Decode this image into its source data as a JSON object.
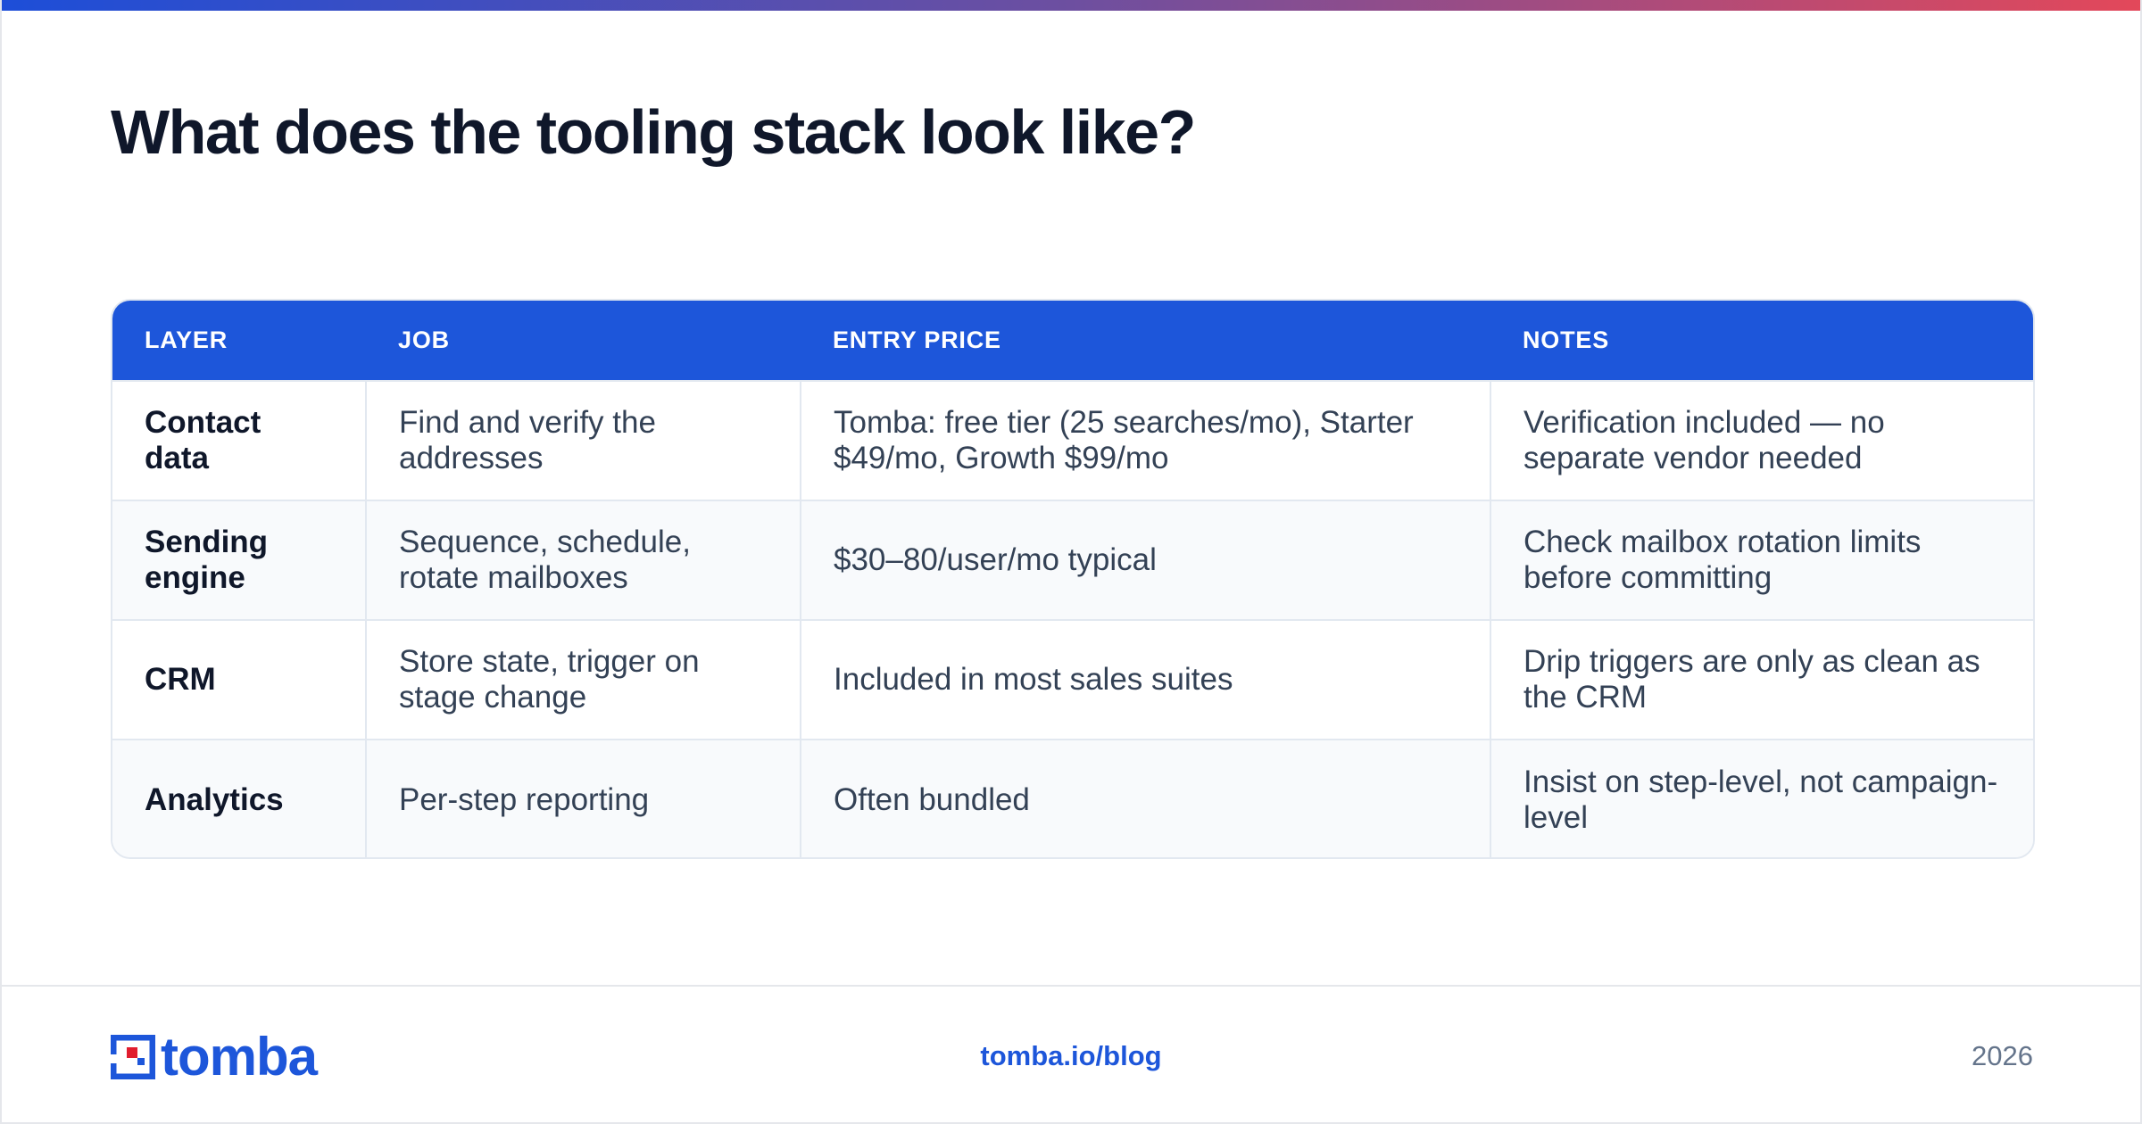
{
  "title": "What does the tooling stack look like?",
  "table": {
    "headers": [
      "LAYER",
      "JOB",
      "ENTRY PRICE",
      "NOTES"
    ],
    "rows": [
      {
        "layer": "Contact data",
        "job": "Find and verify the addresses",
        "price": "Tomba: free tier (25 searches/mo), Starter $49/mo, Growth $99/mo",
        "notes": "Verification included — no separate vendor needed"
      },
      {
        "layer": "Sending engine",
        "job": "Sequence, schedule, rotate mailboxes",
        "price": "$30–80/user/mo typical",
        "notes": "Check mailbox rotation limits before committing"
      },
      {
        "layer": "CRM",
        "job": "Store state, trigger on stage change",
        "price": "Included in most sales suites",
        "notes": "Drip triggers are only as clean as the CRM"
      },
      {
        "layer": "Analytics",
        "job": "Per-step reporting",
        "price": "Often bundled",
        "notes": "Insist on step-level, not campaign-level"
      }
    ]
  },
  "footer": {
    "brand": "tomba",
    "link": "tomba.io/blog",
    "year": "2026"
  },
  "colors": {
    "accent": "#1d56da",
    "gradient_start": "#1d4ed8",
    "gradient_end": "#e3485a",
    "logo_red": "#e11d2e"
  }
}
